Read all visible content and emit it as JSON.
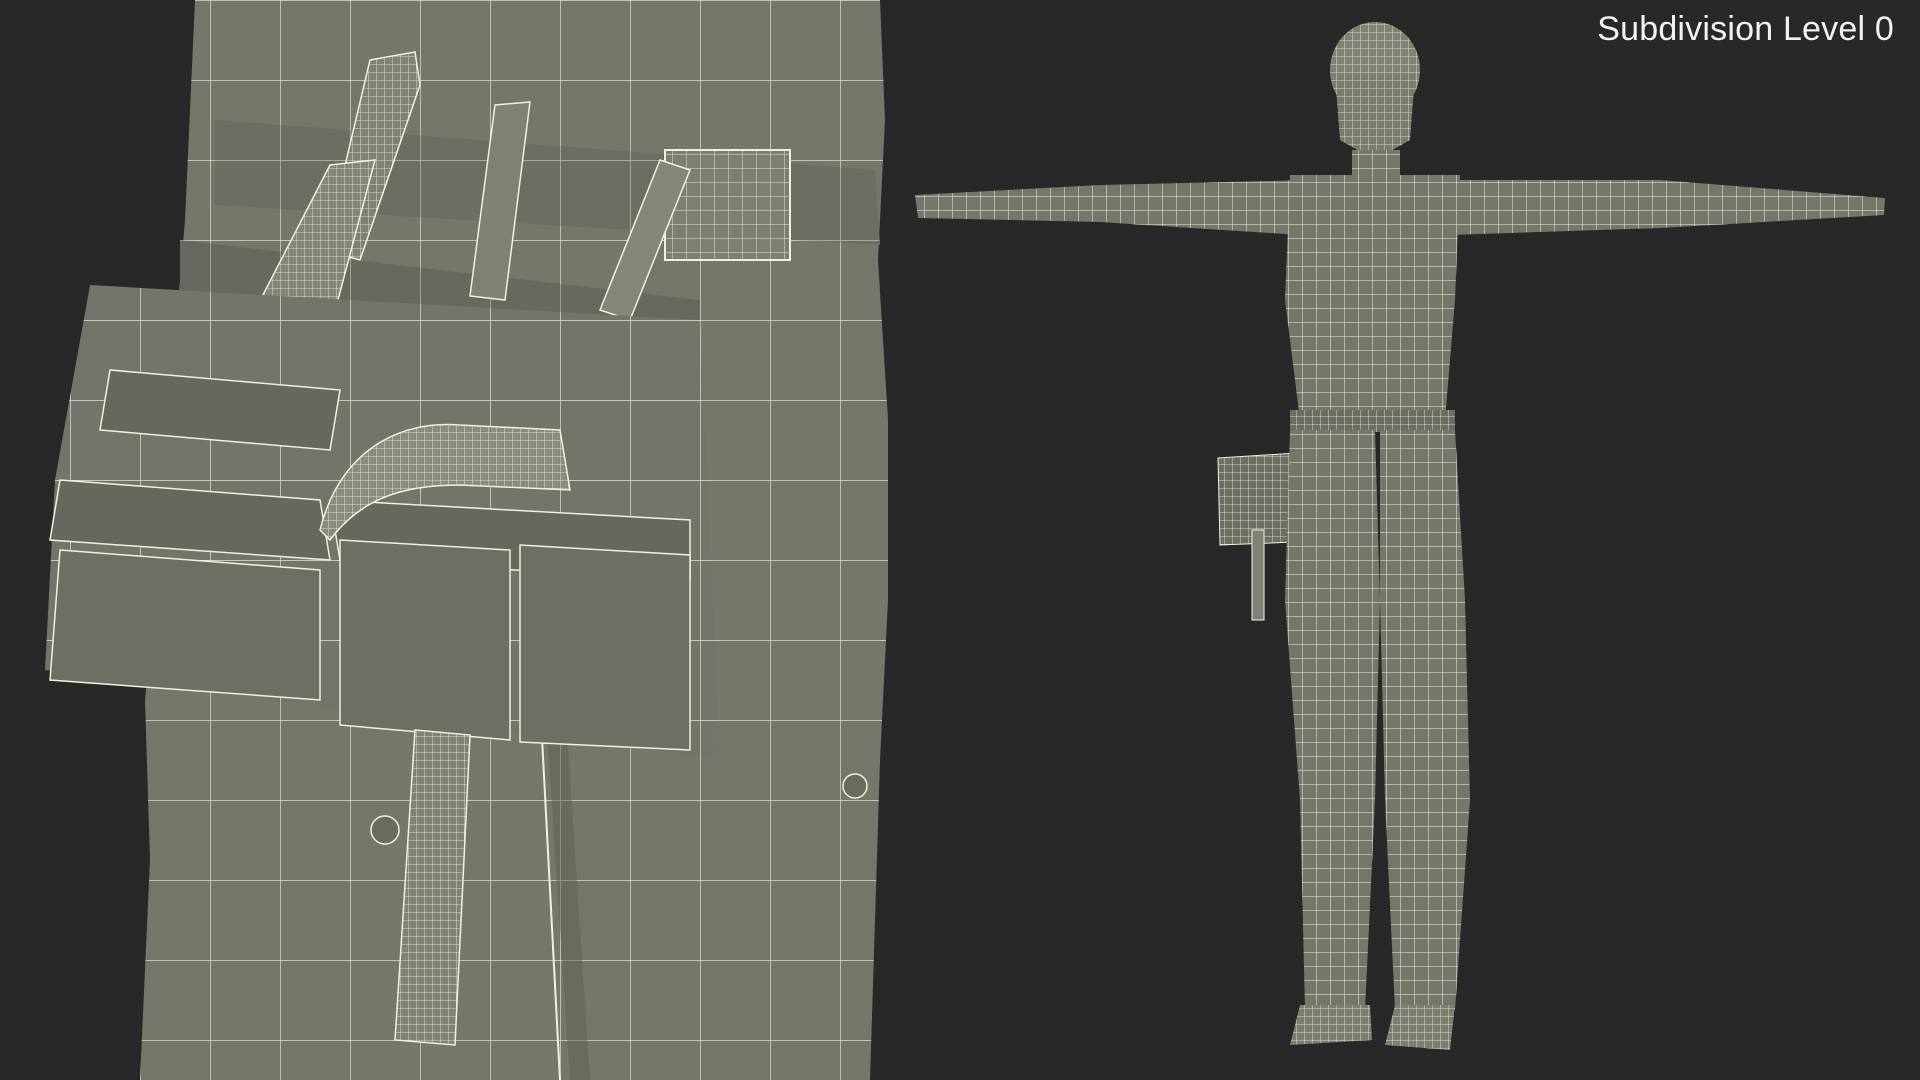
{
  "viewport": {
    "label": "Subdivision Level 0"
  },
  "colors": {
    "background": "#282828",
    "mesh_fill": "#76776b",
    "mesh_shadow": "#5d5e54",
    "mesh_light": "#8b8c80",
    "wire": "#f2f0dc"
  }
}
